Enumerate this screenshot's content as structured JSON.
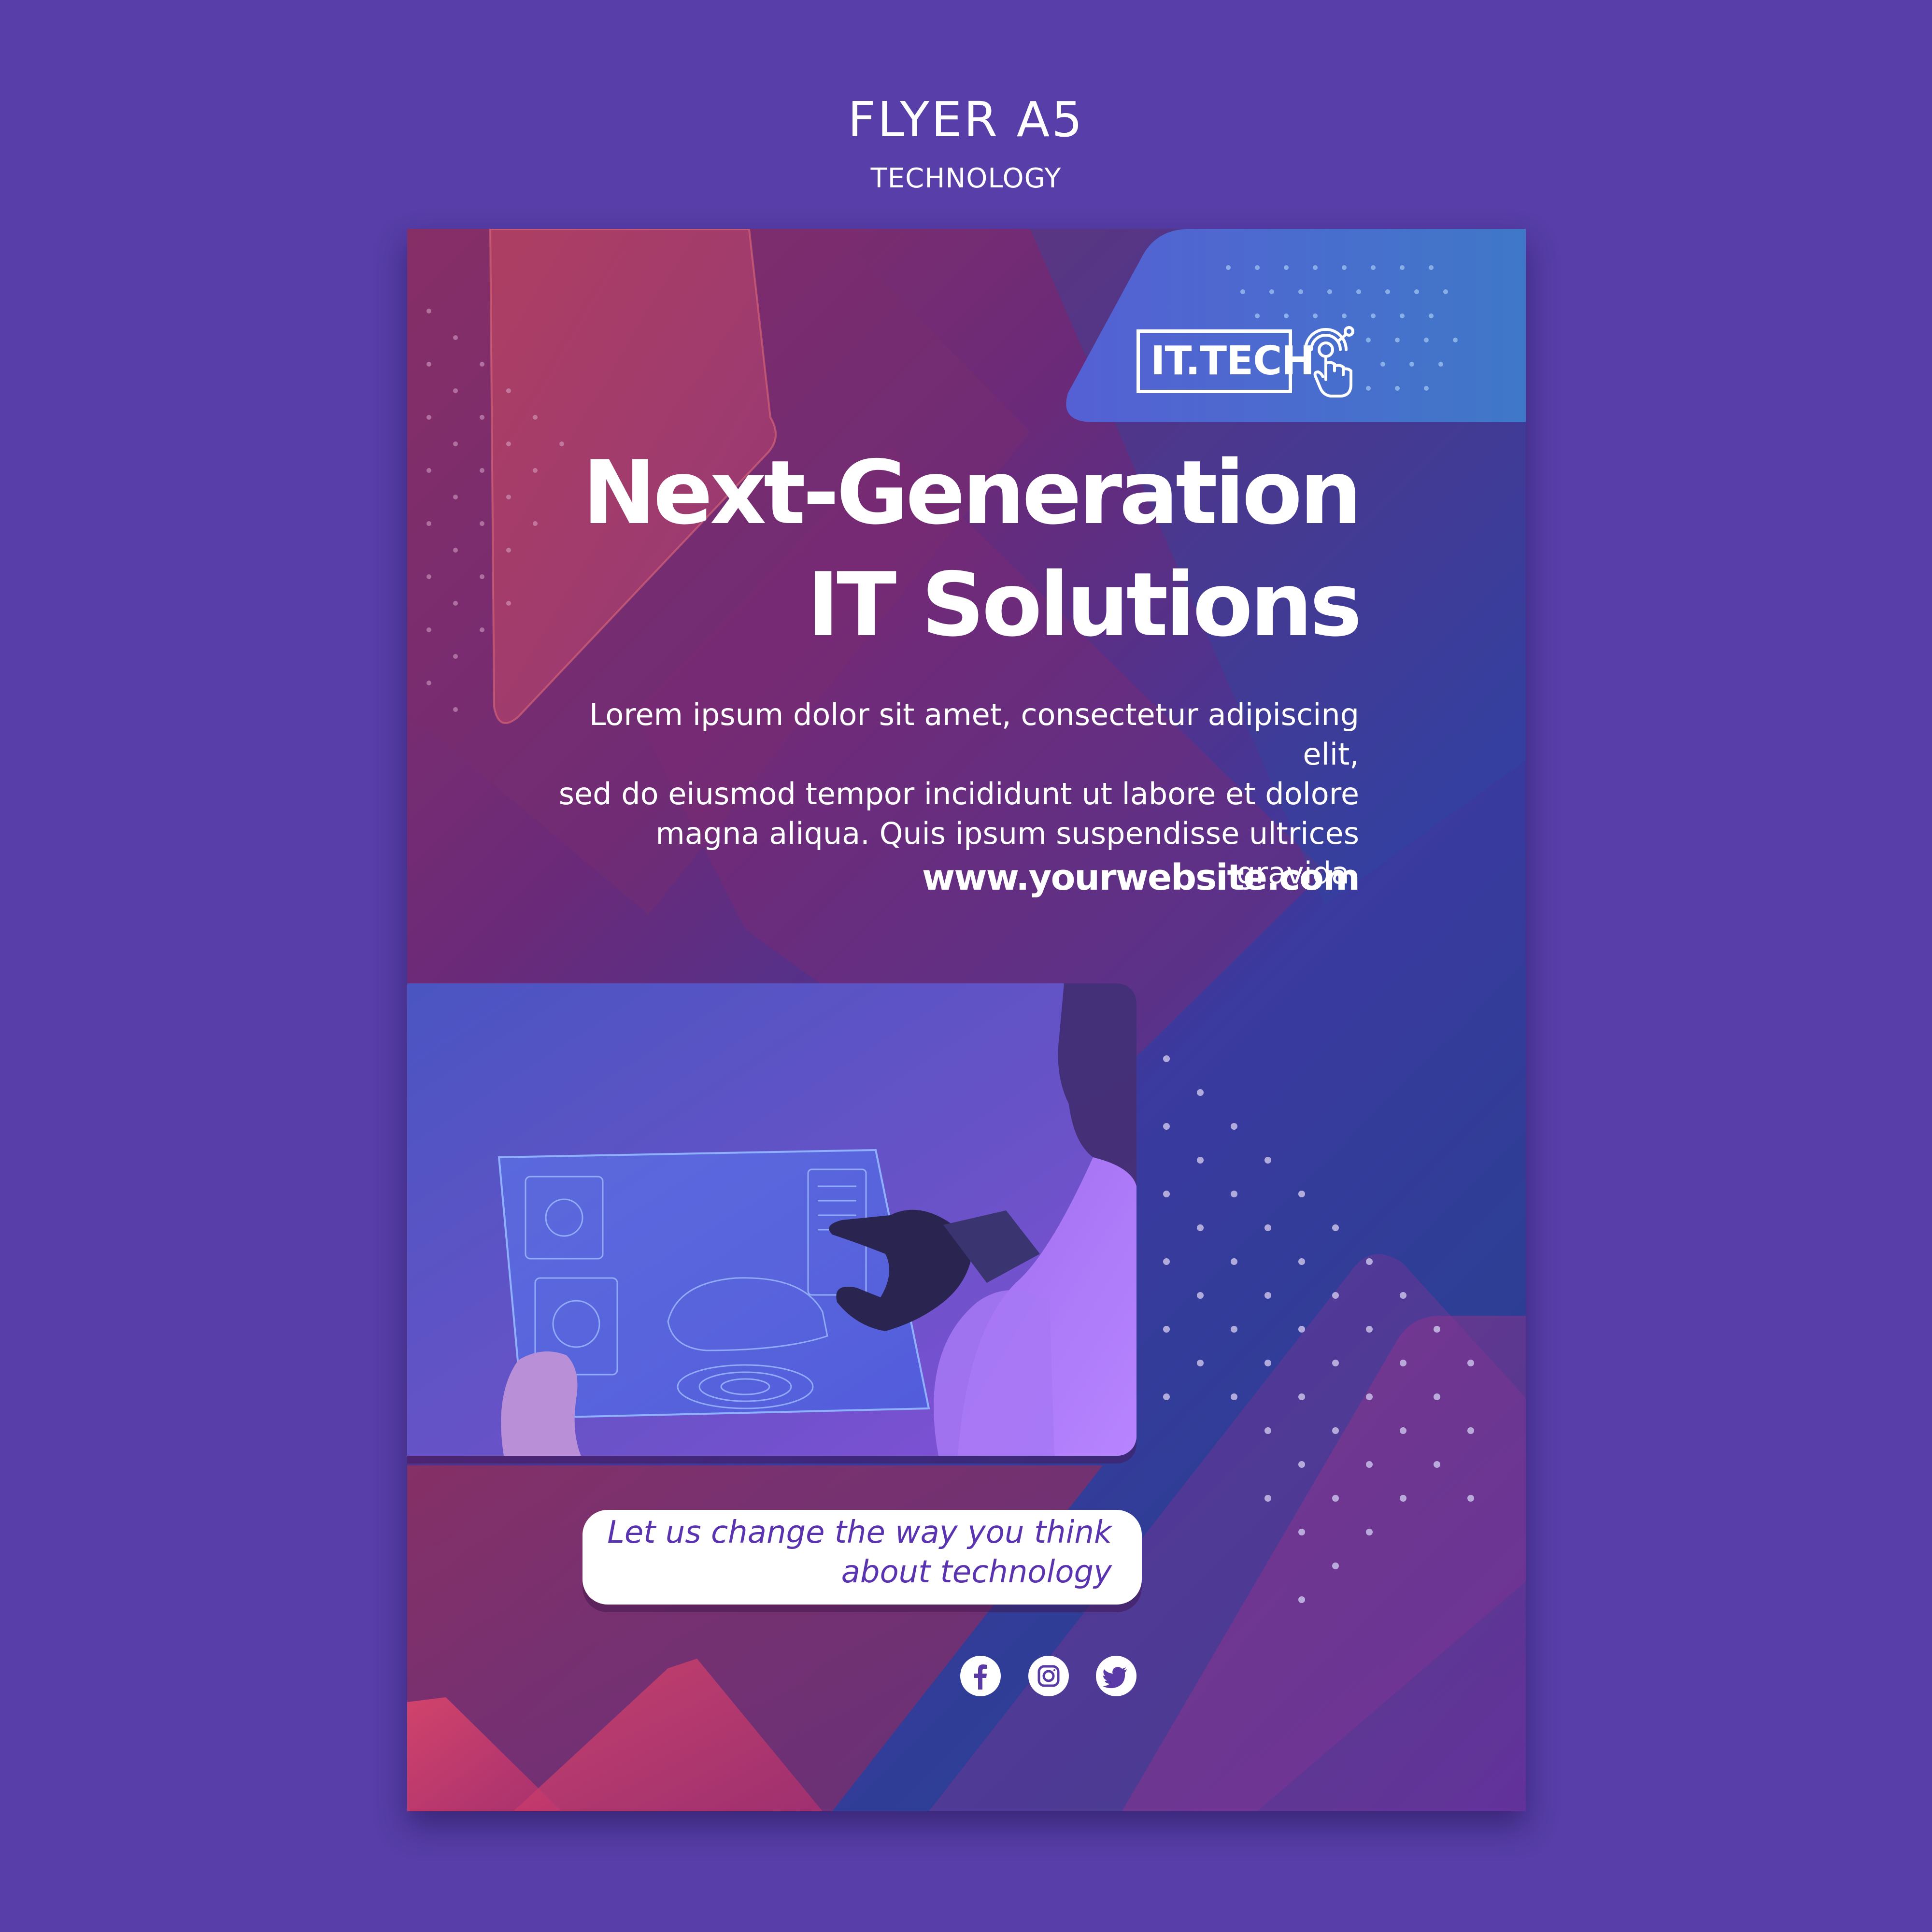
{
  "header": {
    "title": "FLYER A5",
    "subtitle": "TECHNOLOGY"
  },
  "flyer": {
    "logo": "IT.TECH",
    "logo_icon": "touch-target-icon",
    "headline_line1": "Next-Generation",
    "headline_line2": "IT Solutions",
    "body_line1": "Lorem ipsum dolor sit amet, consectetur adipiscing elit,",
    "body_line2": "sed do eiusmod tempor incididunt ut labore et dolore",
    "body_line3": "magna aliqua. Quis ipsum suspendisse ultrices gravida.",
    "website": "www.yourwebsite.com",
    "photo_alt": "person with robotic hand using holographic tablet",
    "tagline_line1": "Let us change the way you think",
    "tagline_line2": "about technology",
    "social_icons": [
      "facebook-icon",
      "instagram-icon",
      "twitter-icon"
    ]
  },
  "colors": {
    "page_background": "#573ea8",
    "accent_blue": "#3f6bd0",
    "accent_pink": "#c43a6a",
    "tagline_text": "#5a33b0",
    "white": "#ffffff"
  }
}
